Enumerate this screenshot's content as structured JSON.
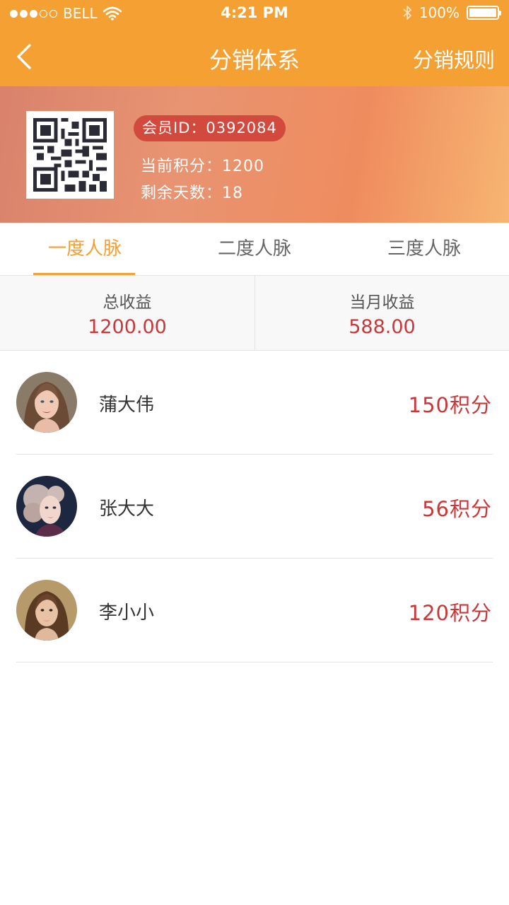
{
  "status_bar": {
    "carrier": "BELL",
    "time": "4:21 PM",
    "battery": "100%",
    "signal_bars_filled": 3,
    "signal_bars_total": 5
  },
  "nav": {
    "title": "分销体系",
    "right_action": "分销规则"
  },
  "member": {
    "id_text": "会员ID：0392084",
    "points_text": "当前积分：1200",
    "days_text": "剩余天数：18"
  },
  "tabs": [
    {
      "label": "一度人脉",
      "active": true
    },
    {
      "label": "二度人脉",
      "active": false
    },
    {
      "label": "三度人脉",
      "active": false
    }
  ],
  "earnings": {
    "total_label": "总收益",
    "total_value": "1200.00",
    "month_label": "当月收益",
    "month_value": "588.00"
  },
  "members": [
    {
      "name": "蒲大伟",
      "score": "150积分"
    },
    {
      "name": "张大大",
      "score": "56积分"
    },
    {
      "name": "李小小",
      "score": "120积分"
    }
  ],
  "colors": {
    "accent": "#f5a032",
    "value_red": "#c8383a",
    "badge_red": "#d14a3d"
  }
}
